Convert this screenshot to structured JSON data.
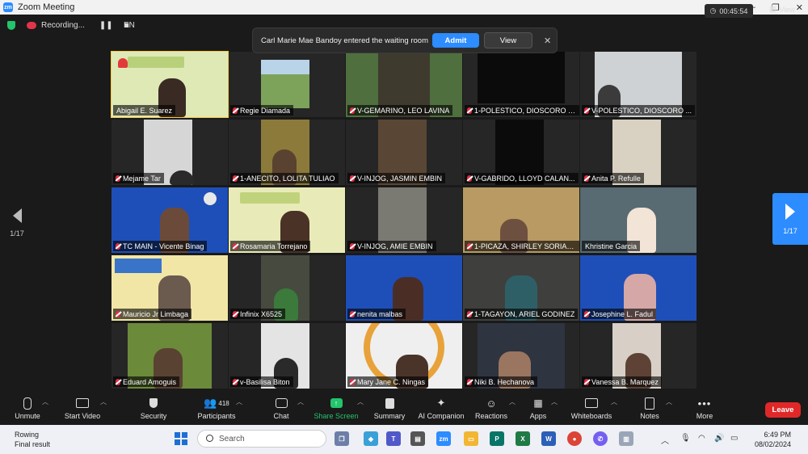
{
  "window": {
    "title": "Zoom Meeting",
    "logo": "zm"
  },
  "topbar": {
    "recording_label": "Recording...",
    "language": "EN",
    "timer": "00:45:54",
    "view_label": "View"
  },
  "notification": {
    "message": "Carl Marie Mae Bandoy entered the waiting room",
    "admit_label": "Admit",
    "view_label": "View",
    "close": "✕"
  },
  "page_indicator": {
    "left": "1/17",
    "right": "1/17"
  },
  "participants": [
    "Abigail E. Suarez",
    "Regie Diamada",
    "V-GEMARINO, LEO LAVINA",
    "1-POLESTICO, DIOSCORO QUI...",
    "V-POLESTICO, DIOSCORO ...",
    "Mejame Tar",
    "1-ANECITO, LOLITA TULIAO",
    "V-INJOG, JASMIN EMBIN",
    "V-GABRIDO, LLOYD CALAN...",
    "Anita P. Refulle",
    "TC MAIN - Vicente Binag",
    "Rosamaria Torrejano",
    "V-INJOG, AMIE EMBIN",
    "1-PICAZA, SHIRLEY SORIANO",
    "Khristine Garcia",
    "Mauricio Jr Limbaga",
    "Infinix X6525",
    "nenita malbas",
    "1-TAGAYON, ARIEL GODINEZ",
    "Josephine L.  Fadul",
    "Eduard Amoguis",
    "v-Basilisa Biton",
    "Mary Jane C. Ningas",
    "Niki B. Hechanova",
    "Vanessa B. Marquez"
  ],
  "toolbar": {
    "unmute": "Unmute",
    "start_video": "Start Video",
    "security": "Security",
    "participants": "Participants",
    "participants_count": "418",
    "chat": "Chat",
    "share_screen": "Share Screen",
    "summary": "Summary",
    "ai_companion": "AI Companion",
    "reactions": "Reactions",
    "apps": "Apps",
    "whiteboards": "Whiteboards",
    "notes": "Notes",
    "more": "More",
    "leave": "Leave"
  },
  "taskbar": {
    "weather_line1": "Rowing",
    "weather_line2": "Final result",
    "search_placeholder": "Search",
    "time": "6:49 PM",
    "date": "08/02/2024"
  },
  "colors": {
    "accent": "#2d8cff",
    "leave": "#e02828",
    "active_speaker": "#f6c948",
    "muted": "#e02f44"
  }
}
